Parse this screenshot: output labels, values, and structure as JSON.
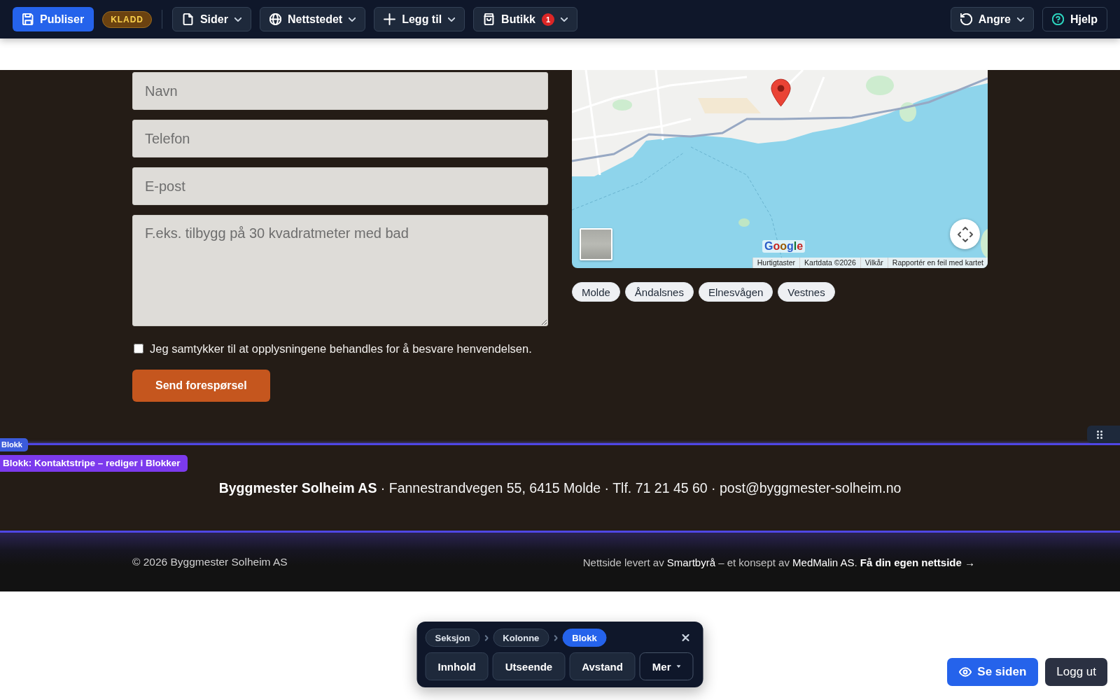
{
  "toolbar": {
    "publish": "Publiser",
    "status": "KLADD",
    "menus": [
      {
        "label": "Sider",
        "kind": "page"
      },
      {
        "label": "Nettstedet",
        "kind": "globe"
      },
      {
        "label": "Legg til",
        "kind": "add"
      },
      {
        "label": "Butikk",
        "kind": "shop",
        "badge": "1"
      }
    ],
    "undo": "Angre",
    "help": "Hjelp"
  },
  "contact_form": {
    "fields": [
      {
        "placeholder": "Navn",
        "kind": "input"
      },
      {
        "placeholder": "Telefon",
        "kind": "input"
      },
      {
        "placeholder": "E-post",
        "kind": "input"
      },
      {
        "placeholder": "F.eks. tilbygg på 30 kvadratmeter med bad",
        "kind": "textarea"
      }
    ],
    "consent": {
      "label": "Jeg samtykker til at opplysningene behandles for å besvare henvendelsen.",
      "checked": false
    },
    "submit": "Send forespørsel"
  },
  "map": {
    "logo": "Google",
    "attribution": [
      "Hurtigtaster",
      "Kartdata ©2026",
      "Vilkår",
      "Rapportér en feil med kartet"
    ]
  },
  "location_chips": [
    {
      "label": "Molde"
    },
    {
      "label": "Åndalsnes"
    },
    {
      "label": "Elnesvågen"
    },
    {
      "label": "Vestnes"
    }
  ],
  "block_overlay": {
    "tab": "Blokk",
    "label": "Blokk: Kontaktstripe – rediger i Blokker"
  },
  "contact_strip": {
    "text": "**Byggmester Solheim AS** · Fannestrandvegen 55, 6415 Molde · Tlf. 71 21 45 60 · post@byggmester-solheim.no"
  },
  "footer": {
    "copyright": "© 2026 Byggmester Solheim AS",
    "credit": [
      {
        "text": "Nettside levert av ",
        "kind": "text"
      },
      {
        "text": "Smartbyrå",
        "kind": "link"
      },
      {
        "text": " – et konsept av ",
        "kind": "text"
      },
      {
        "text": "MedMalin AS",
        "kind": "link"
      },
      {
        "text": ". ",
        "kind": "text"
      },
      {
        "text": "Få din egen nettside →",
        "kind": "cta"
      }
    ]
  },
  "editor_panel": {
    "breadcrumbs": [
      {
        "label": "Seksjon",
        "selected": false
      },
      {
        "label": "Kolonne",
        "selected": false
      },
      {
        "label": "Blokk",
        "selected": true
      }
    ],
    "actions": [
      {
        "label": "Innhold",
        "kind": "button"
      },
      {
        "label": "Utseende",
        "kind": "button"
      },
      {
        "label": "Avstand",
        "kind": "button"
      },
      {
        "label": "Mer",
        "kind": "menu"
      }
    ]
  },
  "page_actions": {
    "view": "Se siden",
    "logout": "Logg ut"
  }
}
